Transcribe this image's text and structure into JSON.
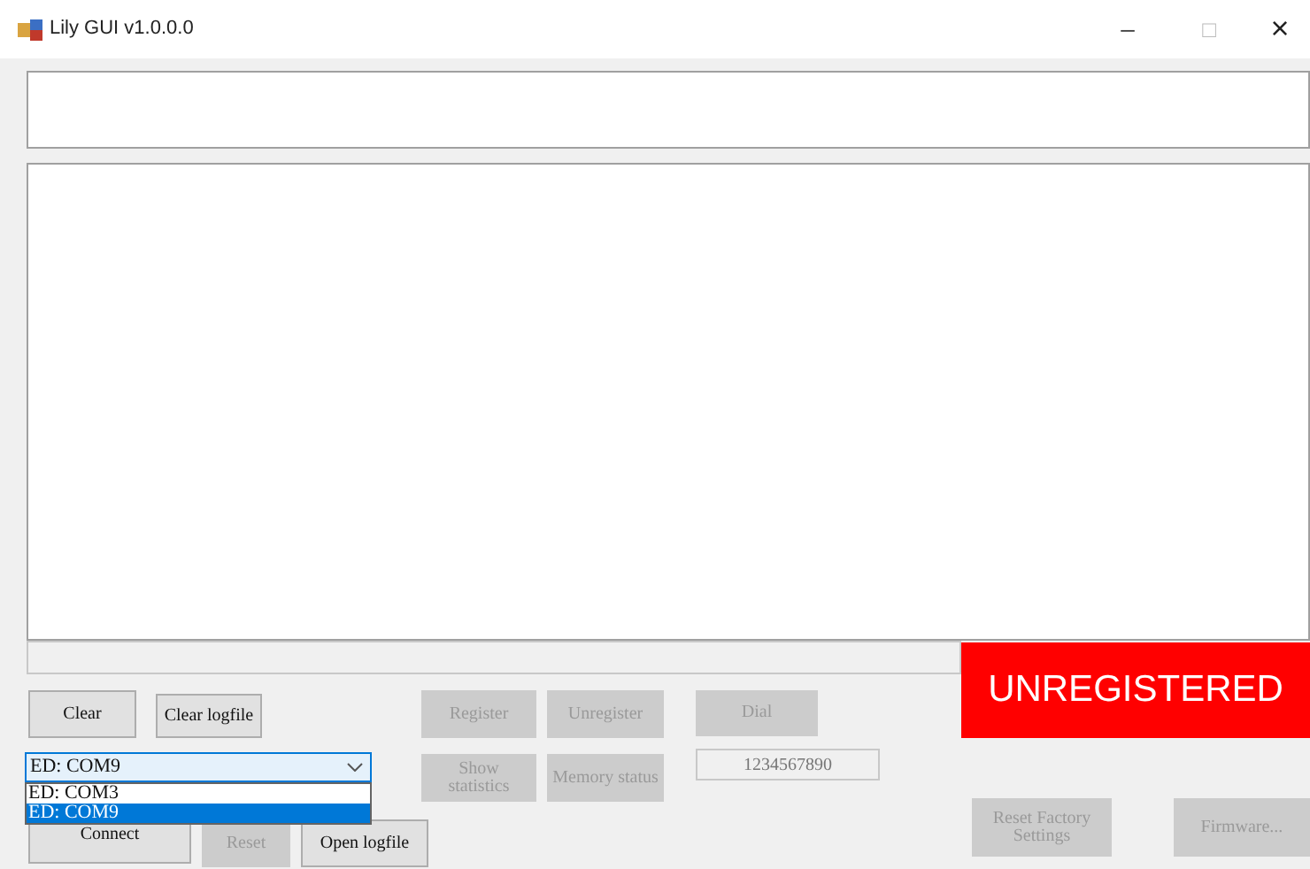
{
  "window": {
    "title": "Lily GUI v1.0.0.0",
    "controls": [
      "–",
      "□",
      "×"
    ]
  },
  "registration_status": "UNREGISTERED",
  "buttons": [
    {
      "label": "Clear",
      "disabled": false
    },
    {
      "label": "Clear logfile",
      "disabled": false
    },
    {
      "label": "Register",
      "disabled": true
    },
    {
      "label": "Unregister",
      "disabled": true
    },
    {
      "label": "Dial",
      "disabled": true
    },
    {
      "label": "Show statistics",
      "disabled": true
    },
    {
      "label": "Memory status",
      "disabled": true
    },
    {
      "label": "Connect",
      "disabled": false
    },
    {
      "label": "Reset",
      "disabled": true
    },
    {
      "label": "Open logfile",
      "disabled": false
    },
    {
      "label": "Reset Factory Settings",
      "disabled": true
    },
    {
      "label": "Firmware...",
      "disabled": true
    }
  ],
  "port_select": {
    "value": "ED: COM9",
    "expanded": true,
    "options": [
      {
        "label": "ED: COM3",
        "selected": false
      },
      {
        "label": "ED: COM9",
        "selected": true
      }
    ]
  },
  "number_field": {
    "value": "1234567890"
  }
}
